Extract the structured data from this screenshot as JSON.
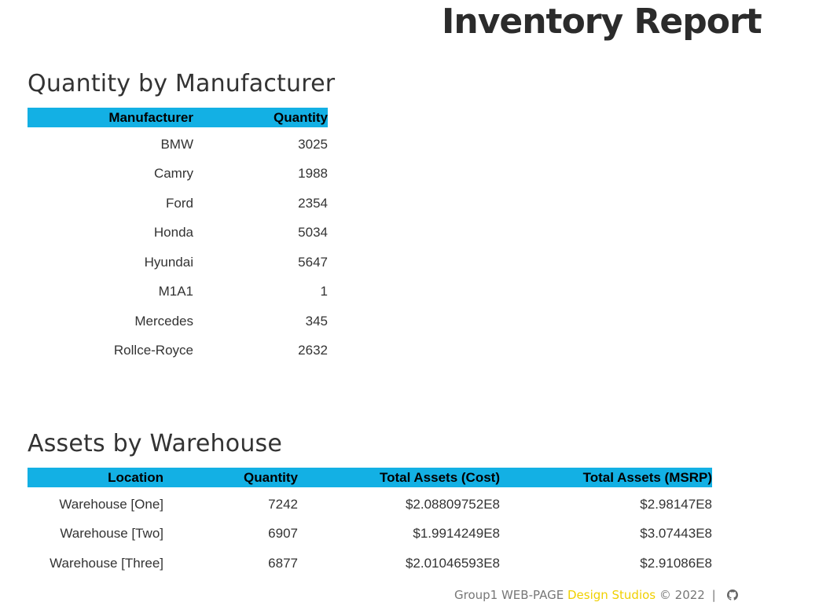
{
  "page": {
    "title": "Inventory Report"
  },
  "manufacturer_section": {
    "title": "Quantity by Manufacturer",
    "columns": [
      "Manufacturer",
      "Quantity"
    ],
    "rows": [
      [
        "BMW",
        "3025"
      ],
      [
        "Camry",
        "1988"
      ],
      [
        "Ford",
        "2354"
      ],
      [
        "Honda",
        "5034"
      ],
      [
        "Hyundai",
        "5647"
      ],
      [
        "M1A1",
        "1"
      ],
      [
        "Mercedes",
        "345"
      ],
      [
        "Rollce-Royce",
        "2632"
      ]
    ]
  },
  "warehouse_section": {
    "title": "Assets by Warehouse",
    "columns": [
      "Location",
      "Quantity",
      "Total Assets (Cost)",
      "Total Assets (MSRP)"
    ],
    "rows": [
      [
        "Warehouse [One]",
        "7242",
        "$2.08809752E8",
        "$2.98147E8"
      ],
      [
        "Warehouse [Two]",
        "6907",
        "$1.9914249E8",
        "$3.07443E8"
      ],
      [
        "Warehouse [Three]",
        "6877",
        "$2.01046593E8",
        "$2.91086E8"
      ]
    ]
  },
  "footer": {
    "prefix": "Group1 WEB-PAGE",
    "brand": "Design Studios",
    "copyright": "© 2022",
    "separator": "|",
    "icon": "github-icon"
  },
  "colors": {
    "header_bg": "#13b0e4",
    "brand": "#f0d000",
    "title": "#2b2b2b"
  }
}
